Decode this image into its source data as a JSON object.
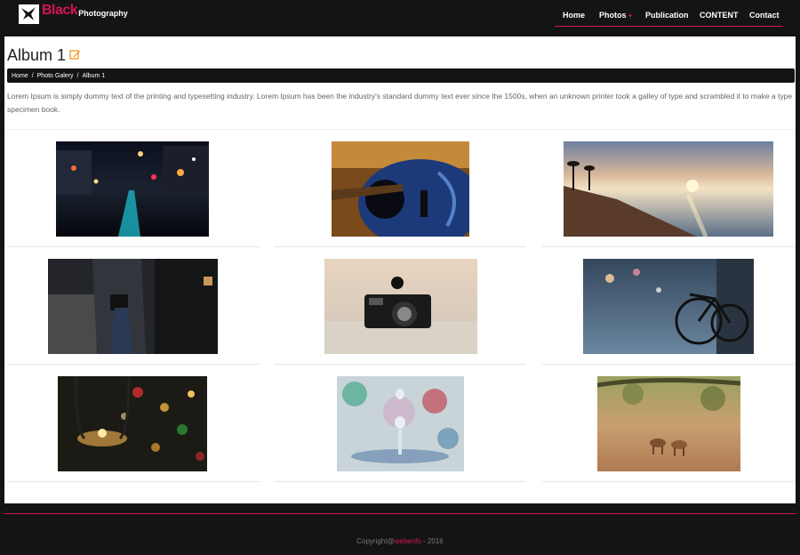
{
  "header": {
    "logo_word1": "Black",
    "logo_word2": "Photography",
    "nav": [
      {
        "label": "Home"
      },
      {
        "label": "Photos"
      },
      {
        "label": "Publication"
      },
      {
        "label": "CONTENT"
      },
      {
        "label": "Contact"
      }
    ],
    "photos_caret": "+"
  },
  "page": {
    "title": "Album 1",
    "breadcrumb": [
      "Home",
      "/",
      "Photo Galery",
      "/",
      "Album 1"
    ],
    "description": "Lorem Ipsum is simply dummy text of the printing and typesetting industry. Lorem Ipsum has been the industry's standard dummy text ever since the 1500s, when an unknown printer took a galley of type and scrambled it to make a type specimen book."
  },
  "gallery": {
    "photos": [
      {
        "name": "city-night-street-photo"
      },
      {
        "name": "guitar-photo"
      },
      {
        "name": "beach-sunset-photo"
      },
      {
        "name": "photographer-with-camera-photo"
      },
      {
        "name": "vintage-camera-photo"
      },
      {
        "name": "bicycle-photo"
      },
      {
        "name": "candle-lantern-bokeh-photo"
      },
      {
        "name": "water-droplet-photo"
      },
      {
        "name": "deer-in-field-photo"
      }
    ]
  },
  "footer": {
    "prefix": "Copyright@",
    "brand": "webenfo",
    "suffix": " - 2016"
  },
  "colors": {
    "accent": "#d4145a",
    "dark": "#141414",
    "edit_icon": "#f0a030"
  }
}
